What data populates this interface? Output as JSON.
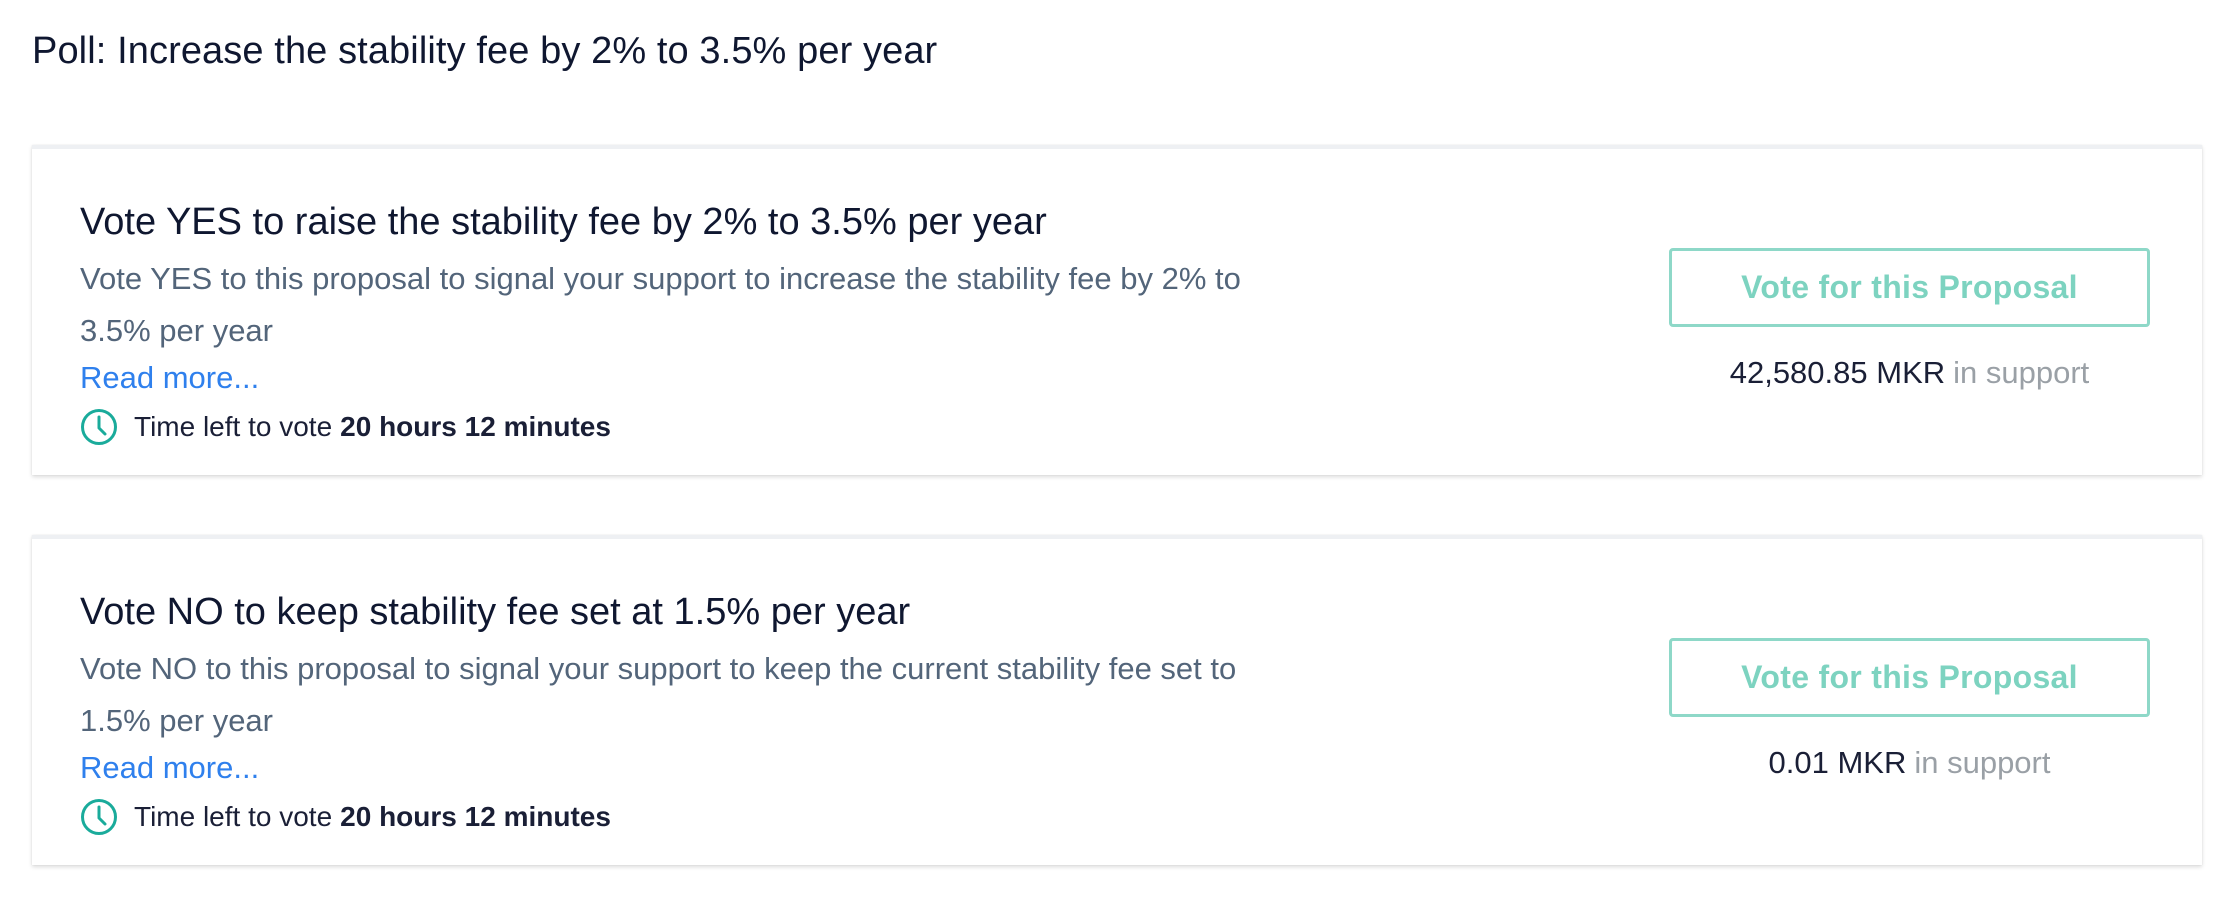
{
  "poll": {
    "title": "Poll: Increase the stability fee by 2% to 3.5% per year"
  },
  "proposals": [
    {
      "title": "Vote YES to raise the stability fee by 2% to 3.5% per year",
      "description": "Vote YES to this proposal to signal your support to increase the stability fee by 2% to 3.5% per year",
      "read_more": "Read more...",
      "time_label": "Time left to vote",
      "time_value": "20 hours 12 minutes",
      "button_label": "Vote for this Proposal",
      "support_amount": "42,580.85 MKR",
      "support_label": "in support"
    },
    {
      "title": "Vote NO to keep stability fee set at 1.5% per year",
      "description": "Vote NO to this proposal to signal your support to keep the current stability fee set to 1.5% per year",
      "read_more": "Read more...",
      "time_label": "Time left to vote",
      "time_value": "20 hours 12 minutes",
      "button_label": "Vote for this Proposal",
      "support_amount": "0.01 MKR",
      "support_label": "in support"
    }
  ],
  "icons": {
    "clock": "clock-icon"
  },
  "colors": {
    "accent_teal": "#1aab9b",
    "button_border": "#8ed8c8",
    "button_text": "#7dd3c0",
    "link_blue": "#2f80ed",
    "muted_gray": "#9aa0a6",
    "description_gray": "#53657a"
  }
}
